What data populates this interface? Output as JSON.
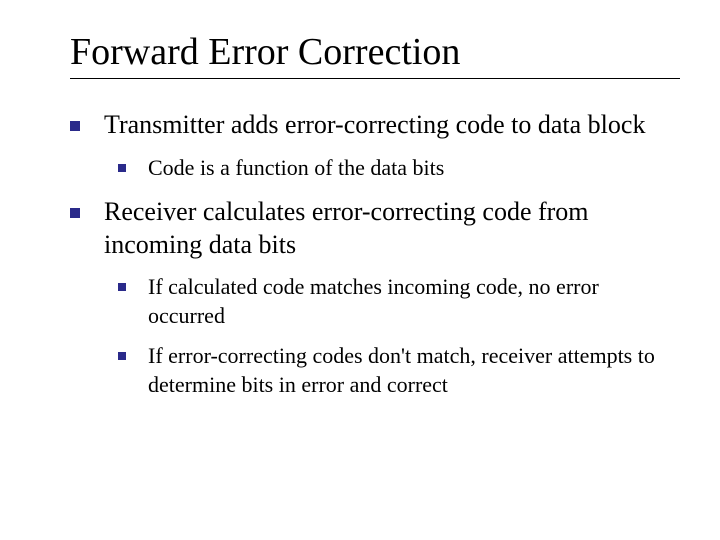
{
  "title": "Forward Error Correction",
  "bullets": [
    {
      "text": "Transmitter adds error-correcting code to data block",
      "children": [
        {
          "text": "Code is a function of the data bits"
        }
      ]
    },
    {
      "text": "Receiver calculates error-correcting code from incoming data bits",
      "children": [
        {
          "text": "If calculated code matches incoming code, no error occurred"
        },
        {
          "text": "If error-correcting codes don't match, receiver attempts to determine bits in error and correct"
        }
      ]
    }
  ]
}
